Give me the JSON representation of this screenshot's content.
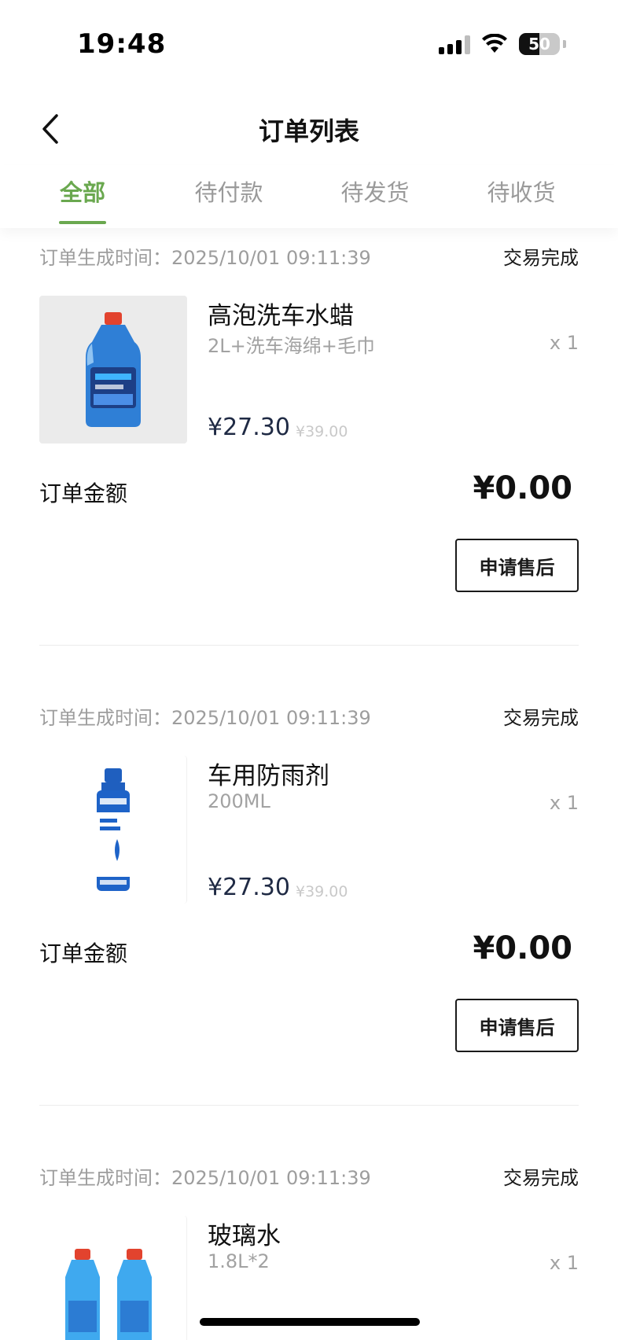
{
  "status_bar": {
    "time": "19:48",
    "battery": "50"
  },
  "nav": {
    "title": "订单列表"
  },
  "tabs": [
    {
      "label": "全部",
      "active": true
    },
    {
      "label": "待付款",
      "active": false
    },
    {
      "label": "待发货",
      "active": false
    },
    {
      "label": "待收货",
      "active": false
    }
  ],
  "orders": [
    {
      "time_label": "订单生成时间：2025/10/01 09:11:39",
      "status": "交易完成",
      "product": {
        "name": "高泡洗车水蜡",
        "spec": "2L+洗车海绵+毛巾",
        "qty": "x 1",
        "price": "¥27.30",
        "orig_price": "¥39.00",
        "image": "car-wash-wax-bottle"
      },
      "amount_label": "订单金额",
      "amount": "¥0.00",
      "action": "申请售后"
    },
    {
      "time_label": "订单生成时间：2025/10/01 09:11:39",
      "status": "交易完成",
      "product": {
        "name": "车用防雨剂",
        "spec": "200ML",
        "qty": "x 1",
        "price": "¥27.30",
        "orig_price": "¥39.00",
        "image": "rain-repellent-bottle"
      },
      "amount_label": "订单金额",
      "amount": "¥0.00",
      "action": "申请售后"
    },
    {
      "time_label": "订单生成时间：2025/10/01 09:11:39",
      "status": "交易完成",
      "product": {
        "name": "玻璃水",
        "spec": "1.8L*2",
        "qty": "x 1",
        "image": "windshield-fluid-bottles"
      }
    }
  ],
  "colors": {
    "accent": "#6aa84f",
    "price": "#1f2a44",
    "muted": "#a2a2a2"
  }
}
